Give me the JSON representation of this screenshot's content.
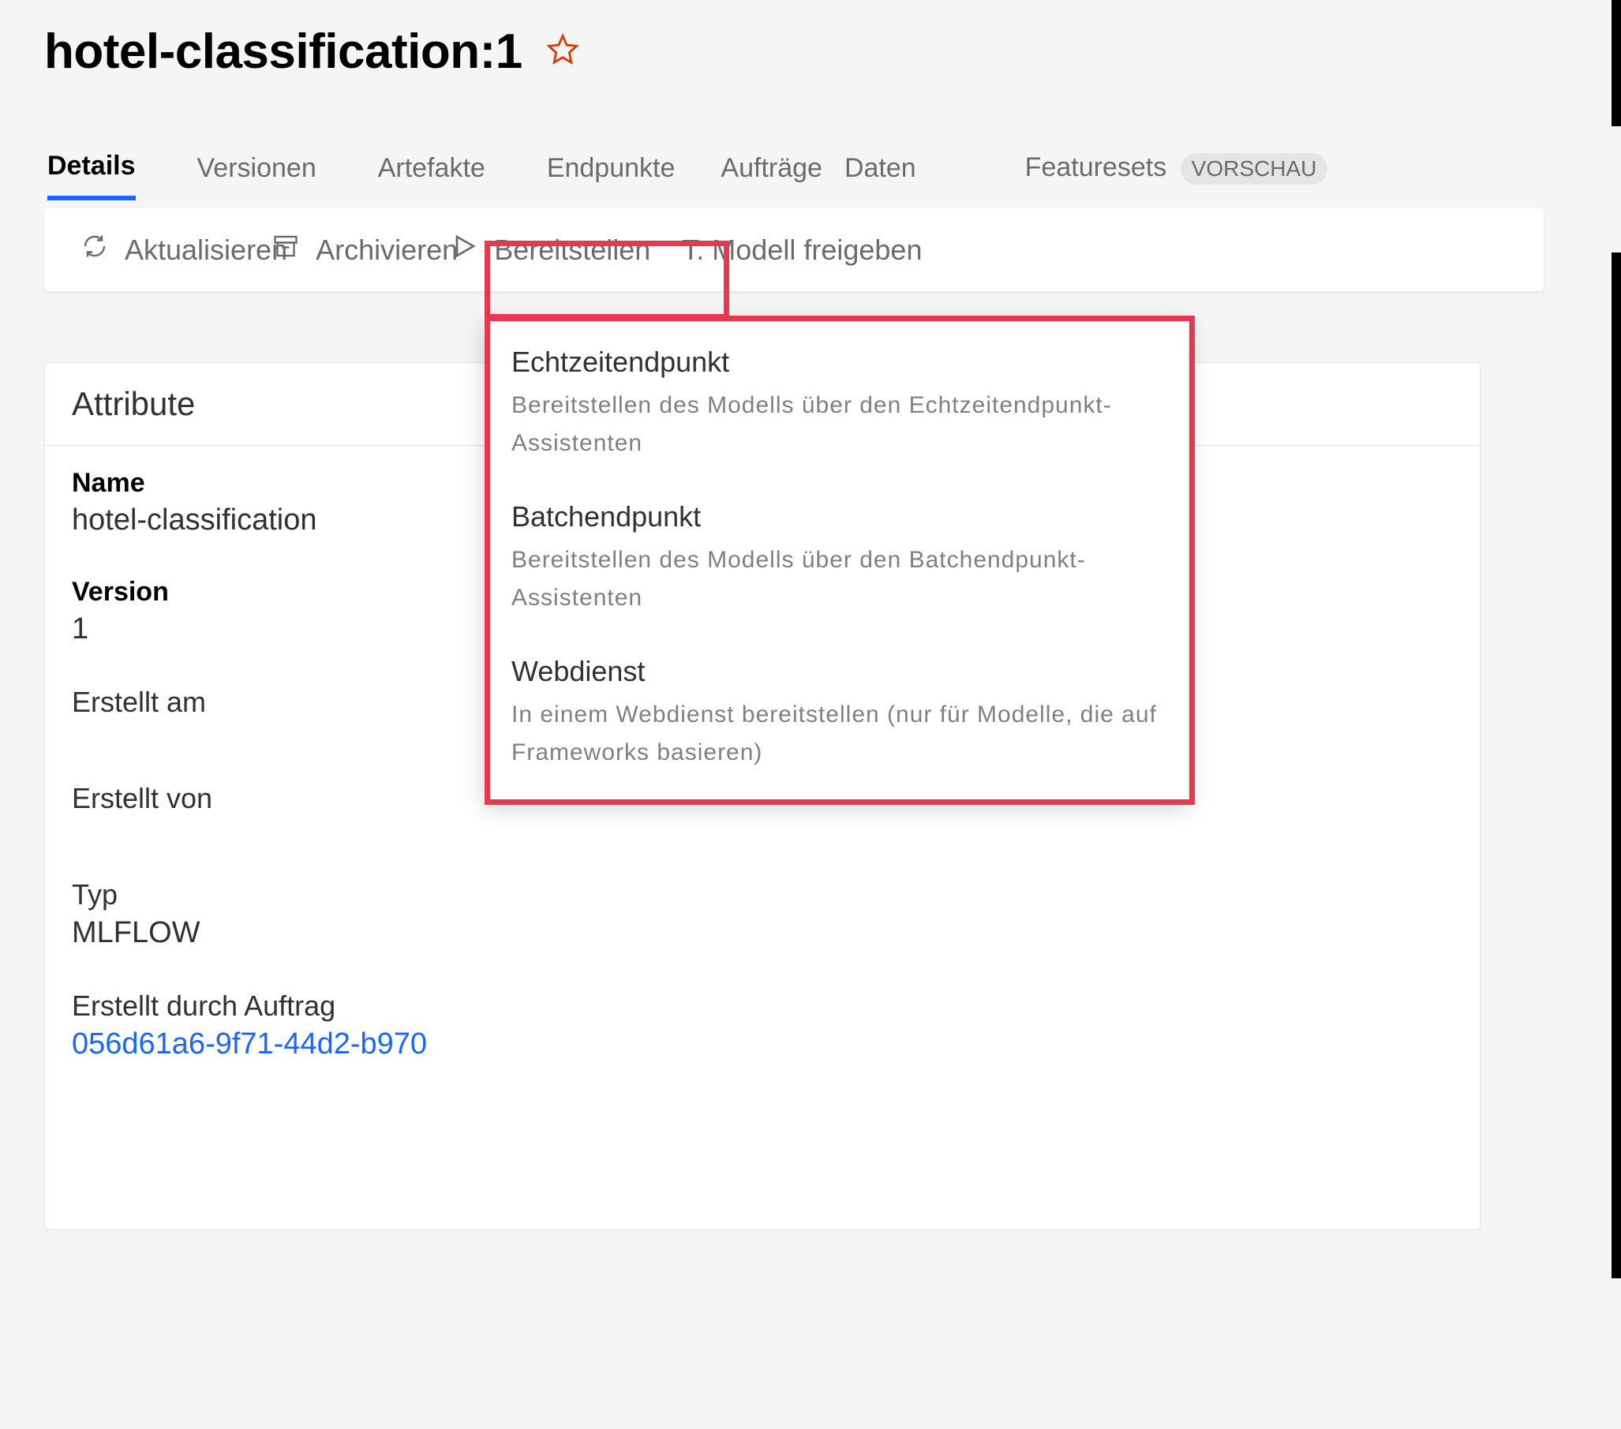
{
  "header": {
    "title": "hotel-classification:1"
  },
  "tabs": [
    {
      "label": "Details",
      "active": true
    },
    {
      "label": "Versionen",
      "active": false
    },
    {
      "label": "Artefakte",
      "active": false
    },
    {
      "label": "Endpunkte",
      "active": false
    },
    {
      "label": "Aufträge",
      "active": false
    },
    {
      "label": "Daten",
      "active": false
    },
    {
      "label_prefix": "Featuresets",
      "badge": "VORSCHAU",
      "active": false
    }
  ],
  "toolbar": {
    "refresh": "Aktualisieren",
    "archive": "Archivieren",
    "deploy": "Bereitstellen",
    "share": "T. Modell freigeben"
  },
  "attributes": {
    "panel_title": "Attribute",
    "name_label": "Name",
    "name_value": "hotel-classification",
    "version_label": "Version",
    "version_value": "1",
    "created_on_label": "Erstellt am",
    "created_by_label": "Erstellt von",
    "type_label": "Typ",
    "type_value": "MLFLOW",
    "created_by_job_label": "Erstellt durch Auftrag",
    "created_by_job_value": "056d61a6-9f71-44d2-b970"
  },
  "dropdown": {
    "items": [
      {
        "title": "Echtzeitendpunkt",
        "desc": "Bereitstellen des Modells über den Echtzeitendpunkt-Assistenten"
      },
      {
        "title": "Batchendpunkt",
        "desc": "Bereitstellen des Modells über den Batchendpunkt-Assistenten"
      },
      {
        "title": "Webdienst",
        "desc": "In einem Webdienst bereitstellen (nur für Modelle, die auf Frameworks basieren)"
      }
    ]
  }
}
